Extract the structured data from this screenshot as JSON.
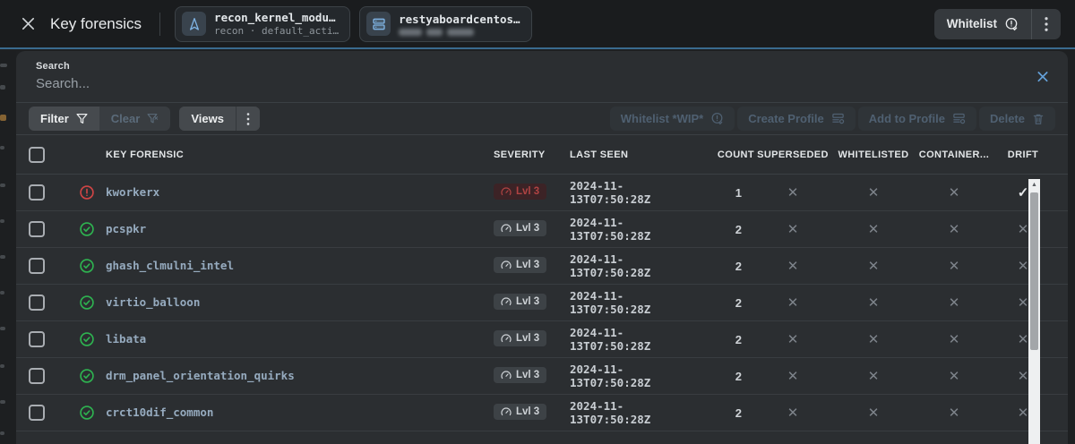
{
  "colors": {
    "accent_line": "#3a6b8f",
    "critical_red": "#c24444",
    "ok_green": "#2eb350",
    "link_text": "#96abbf",
    "clear_search_blue": "#64a0d8"
  },
  "header": {
    "title": "Key forensics",
    "chips": [
      {
        "icon": "navigation-icon",
        "title": "recon_kernel_modu…",
        "subtitle": "recon · default_acti…"
      },
      {
        "icon": "server-icon",
        "title": "restyaboardcentos…",
        "subtitle_redacted": true
      }
    ],
    "whitelist_button": "Whitelist"
  },
  "search": {
    "label": "Search",
    "placeholder": "Search...",
    "value": ""
  },
  "toolbar": {
    "filter": "Filter",
    "clear": "Clear",
    "views": "Views",
    "bulk_actions": [
      {
        "label": "Whitelist *WIP*",
        "icon": "badge-alert-icon",
        "disabled": true
      },
      {
        "label": "Create Profile",
        "icon": "profile-icon",
        "disabled": true
      },
      {
        "label": "Add to Profile",
        "icon": "profile-icon",
        "disabled": true
      },
      {
        "label": "Delete",
        "icon": "trash-icon",
        "disabled": true
      }
    ]
  },
  "table": {
    "columns": [
      "KEY FORENSIC",
      "SEVERITY",
      "LAST SEEN",
      "COUNT",
      "SUPERSEDED",
      "WHITELISTED",
      "CONTAINER...",
      "DRIFT"
    ],
    "rows": [
      {
        "name": "kworkerx",
        "status": "alert",
        "severity": "Lvl 3",
        "critical": true,
        "last_seen": "2024-11-13T07:50:28Z",
        "count": "1",
        "superseded": false,
        "whitelisted": false,
        "container": false,
        "drift": true
      },
      {
        "name": "pcspkr",
        "status": "ok",
        "severity": "Lvl 3",
        "critical": false,
        "last_seen": "2024-11-13T07:50:28Z",
        "count": "2",
        "superseded": false,
        "whitelisted": false,
        "container": false,
        "drift": false
      },
      {
        "name": "ghash_clmulni_intel",
        "status": "ok",
        "severity": "Lvl 3",
        "critical": false,
        "last_seen": "2024-11-13T07:50:28Z",
        "count": "2",
        "superseded": false,
        "whitelisted": false,
        "container": false,
        "drift": false
      },
      {
        "name": "virtio_balloon",
        "status": "ok",
        "severity": "Lvl 3",
        "critical": false,
        "last_seen": "2024-11-13T07:50:28Z",
        "count": "2",
        "superseded": false,
        "whitelisted": false,
        "container": false,
        "drift": false
      },
      {
        "name": "libata",
        "status": "ok",
        "severity": "Lvl 3",
        "critical": false,
        "last_seen": "2024-11-13T07:50:28Z",
        "count": "2",
        "superseded": false,
        "whitelisted": false,
        "container": false,
        "drift": false
      },
      {
        "name": "drm_panel_orientation_quirks",
        "status": "ok",
        "severity": "Lvl 3",
        "critical": false,
        "last_seen": "2024-11-13T07:50:28Z",
        "count": "2",
        "superseded": false,
        "whitelisted": false,
        "container": false,
        "drift": false
      },
      {
        "name": "crct10dif_common",
        "status": "ok",
        "severity": "Lvl 3",
        "critical": false,
        "last_seen": "2024-11-13T07:50:28Z",
        "count": "2",
        "superseded": false,
        "whitelisted": false,
        "container": false,
        "drift": false
      }
    ],
    "flag_true_glyph": "✓",
    "flag_false_glyph": "✕"
  }
}
